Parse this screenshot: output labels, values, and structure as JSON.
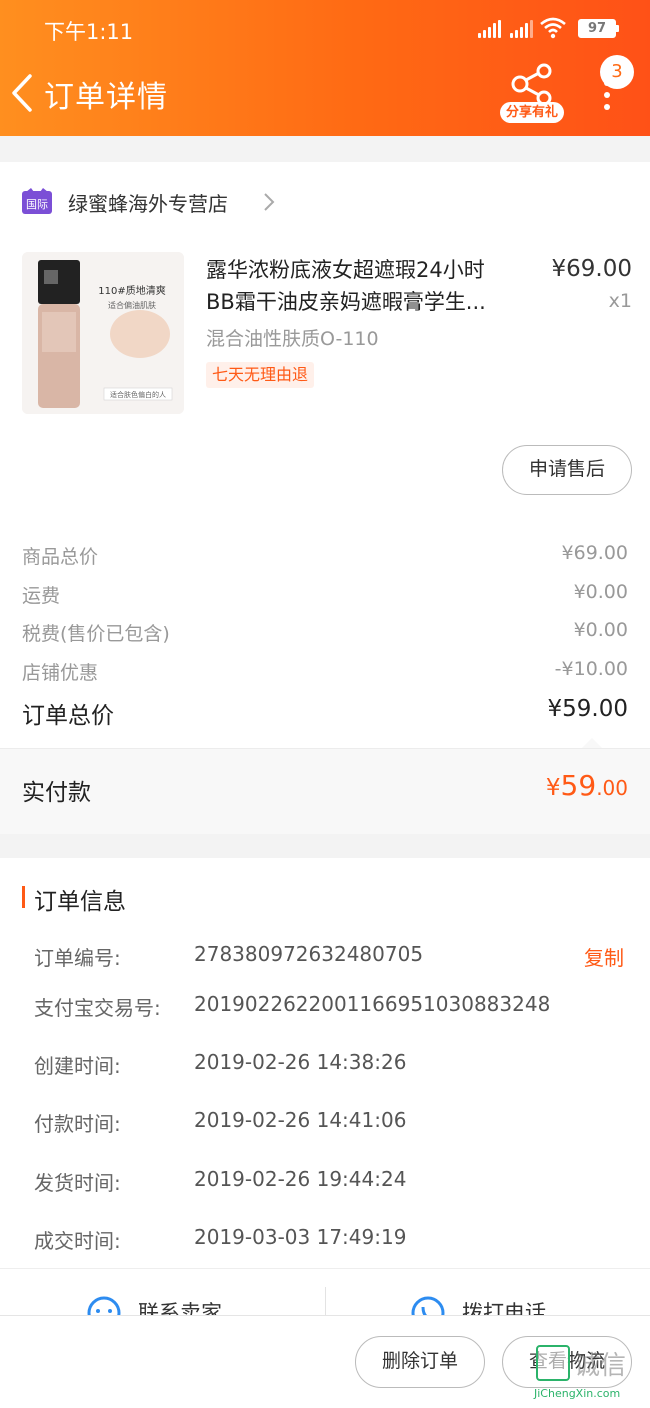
{
  "status_bar": {
    "time": "下午1:11",
    "battery": "97"
  },
  "header": {
    "title": "订单详情",
    "share_label": "分享有礼",
    "badge_count": "3",
    "gradient_colors": [
      "#ff8f1f",
      "#ff5117"
    ]
  },
  "shop": {
    "name": "绿蜜蜂海外专营店",
    "icon": "intl-icon",
    "badge_text": "国际"
  },
  "product": {
    "title_line1": "露华浓粉底液女超遮瑕24小时",
    "title_line2": "BB霜干油皮亲妈遮暇膏学生...",
    "price": "¥69.00",
    "quantity": "x1",
    "spec": "混合油性肤质O-110",
    "tag": "七天无理由退",
    "thumb_text_1": "110#质地清爽",
    "thumb_text_2": "适合偏油肌肤",
    "thumb_text_3": "适合肤色偏白的人"
  },
  "after_sale_label": "申请售后",
  "fees": [
    {
      "label": "商品总价",
      "value": "¥69.00"
    },
    {
      "label": "运费",
      "value": "¥0.00"
    },
    {
      "label": "税费(售价已包含)",
      "value": "¥0.00"
    },
    {
      "label": "店铺优惠",
      "value": "-¥10.00"
    }
  ],
  "total": {
    "label": "订单总价",
    "value": "¥59.00"
  },
  "paid": {
    "label": "实付款",
    "currency": "¥",
    "integer": "59",
    "decimal": ".00",
    "color": "#ff5a16"
  },
  "order_info": {
    "title": "订单信息",
    "copy_label": "复制",
    "rows": [
      {
        "label": "订单编号:",
        "value": "278380972632480705"
      },
      {
        "label": "支付宝交易号:",
        "value": "2019022622001166951030883248"
      },
      {
        "label": "创建时间:",
        "value": "2019-02-26 14:38:26"
      },
      {
        "label": "付款时间:",
        "value": "2019-02-26 14:41:06"
      },
      {
        "label": "发货时间:",
        "value": "2019-02-26 19:44:24"
      },
      {
        "label": "成交时间:",
        "value": "2019-03-03 17:49:19"
      }
    ]
  },
  "contact": {
    "seller_label": "联系卖家",
    "call_label": "拨打电话"
  },
  "actions": {
    "delete_label": "删除订单",
    "logistics_label": "查看物流"
  },
  "watermark": {
    "text": "诚信",
    "url": "JiChengXin.com"
  }
}
